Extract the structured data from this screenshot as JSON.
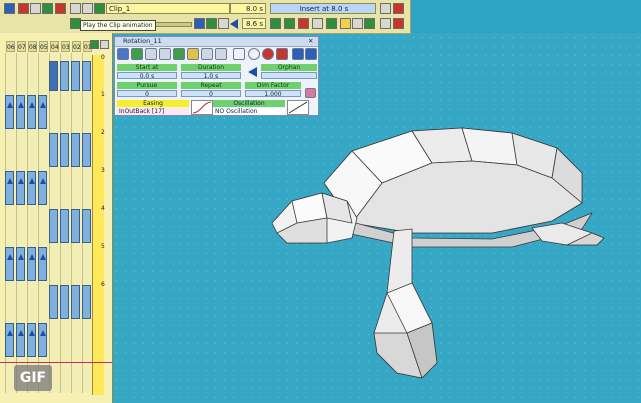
{
  "toolbar": {
    "clip_name": "Clip_1",
    "time_value": "8.0 s",
    "insert_label": "Insert at 8.0 s",
    "secondary_time": "8.6 s",
    "tooltip": "Play the Clip animation"
  },
  "timeline": {
    "track_headers": [
      "06",
      "07",
      "08",
      "05",
      "04",
      "03",
      "02",
      "01"
    ],
    "ruler_ticks": [
      "0",
      "1",
      "2",
      "3",
      "4",
      "5",
      "6"
    ]
  },
  "panel": {
    "title": "Rotation_11",
    "start_at_label": "Start at",
    "start_at_value": "0.0 s",
    "duration_label": "Duration",
    "duration_value": "1.0 s",
    "orphan_label": "Orphan",
    "pursue_label": "Pursue",
    "pursue_value": "0",
    "repeat_label": "Repeat",
    "repeat_value": "0",
    "dim_factor_label": "Dim Factor",
    "dim_factor_value": "1.000",
    "easing_label": "Easing",
    "easing_value": "InOutBack [17]",
    "oscillation_label": "Oscillation",
    "oscillation_value": "NO Oscillation",
    "close_glyph": "✕"
  },
  "badge": {
    "label": "GIF"
  },
  "colors": {
    "water": "#37a7c6",
    "toolbar_bg": "#e8e3a6",
    "timeline_bg": "#f6f1b2",
    "key_blue": "#3f6fb5"
  }
}
